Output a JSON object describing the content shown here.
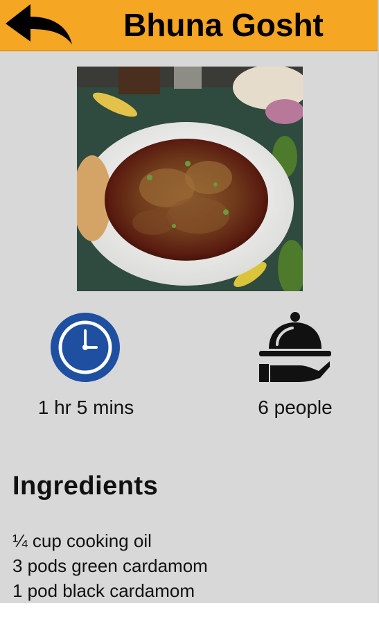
{
  "header": {
    "title": "Bhuna Gosht",
    "back_icon": "back-arrow-icon",
    "background": "#f5a623"
  },
  "recipe": {
    "image_subject": "dish-photo",
    "cook_time_icon": "clock-icon",
    "cook_time": "1 hr 5 mins",
    "servings_icon": "serving-cloche-icon",
    "servings": "6 people"
  },
  "ingredients": {
    "heading": "Ingredients",
    "items": [
      "¼ cup cooking oil",
      "3 pods green cardamom",
      "1 pod black cardamom"
    ]
  },
  "colors": {
    "page_background": "#d8d8d8",
    "clock_blue": "#1f4fa0"
  }
}
